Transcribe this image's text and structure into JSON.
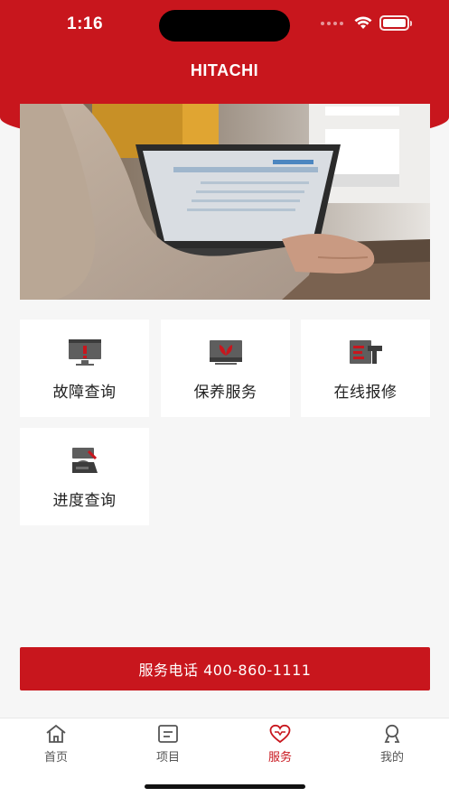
{
  "status_bar": {
    "time": "1:16",
    "icons": [
      "signal-dots-icon",
      "wifi-icon",
      "battery-icon"
    ]
  },
  "header": {
    "brand": "HITACHI"
  },
  "banner": {
    "image": "person-using-laptop-photo"
  },
  "services": [
    {
      "label": "故障查询",
      "icon": "fault-monitor-icon"
    },
    {
      "label": "保养服务",
      "icon": "maintenance-leaf-icon"
    },
    {
      "label": "在线报修",
      "icon": "repair-hammer-icon"
    },
    {
      "label": "进度查询",
      "icon": "progress-inquiry-icon"
    }
  ],
  "hotline": {
    "label": "服务电话 400-860-1111"
  },
  "tabbar": {
    "tabs": [
      {
        "label": "首页",
        "icon": "home-icon",
        "active": false
      },
      {
        "label": "项目",
        "icon": "project-icon",
        "active": false
      },
      {
        "label": "服务",
        "icon": "heart-icon",
        "active": true
      },
      {
        "label": "我的",
        "icon": "profile-icon",
        "active": false
      }
    ]
  },
  "colors": {
    "brand_red": "#c8161d",
    "background": "#f6f6f6"
  }
}
